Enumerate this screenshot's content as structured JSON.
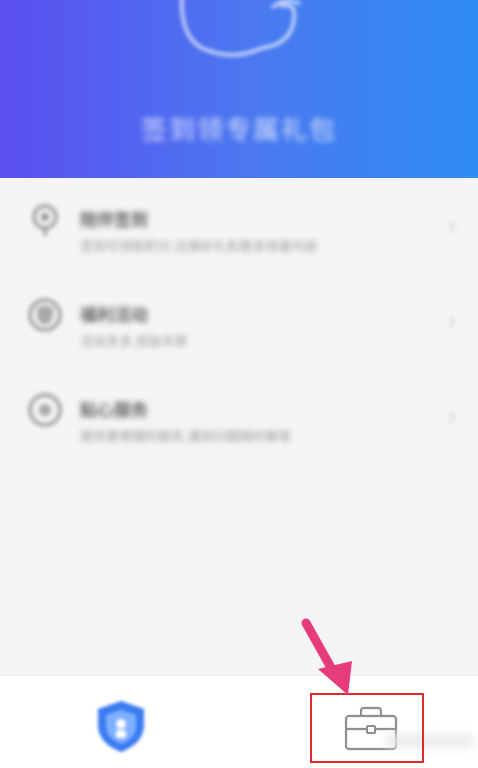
{
  "header": {
    "title": "签到领专属礼包"
  },
  "list": {
    "items": [
      {
        "icon": "location-icon",
        "title": "陪伴签到",
        "subtitle": "签到可领取积分,兑换好礼和更多惊喜内容"
      },
      {
        "icon": "shield-icon",
        "title": "福利活动",
        "subtitle": "活动多多,奖励丰厚"
      },
      {
        "icon": "headset-icon",
        "title": "贴心服务",
        "subtitle": "提供更便捷的服务,遇到问题随时解答"
      }
    ]
  },
  "tabbar": {
    "tabs": [
      {
        "icon": "shield-icon",
        "label": ""
      },
      {
        "icon": "toolbox-icon",
        "label": ""
      }
    ]
  },
  "colors": {
    "header_gradient_start": "#5a4ff0",
    "header_gradient_end": "#2d8cf2",
    "highlight": "#e02a2a",
    "arrow": "#e63c7a",
    "shield_blue": "#3a7bf0"
  }
}
